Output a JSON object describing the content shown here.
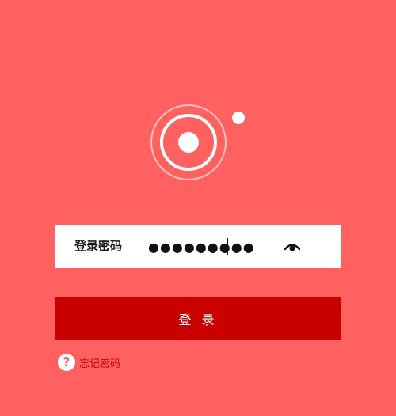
{
  "colors": {
    "background": "#ff6161",
    "button": "#c90000",
    "link": "#c90000",
    "field": "#ffffff"
  },
  "logo": {
    "icon": "brand-logo-icon"
  },
  "password": {
    "label": "登录密码",
    "value": "●●●●●●●●●",
    "toggle_icon": "eye-icon"
  },
  "login_button": {
    "label": "登 录"
  },
  "forgot": {
    "icon": "question-icon",
    "icon_text": "?",
    "label": "忘记密码"
  }
}
